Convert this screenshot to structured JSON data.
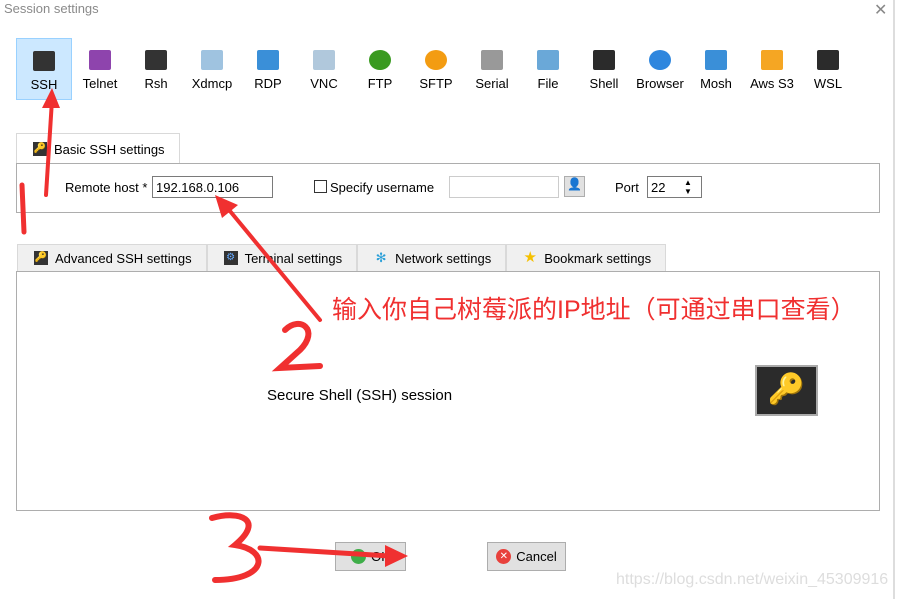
{
  "window": {
    "title": "Session settings",
    "close": "✕"
  },
  "session_types": [
    {
      "label": "SSH",
      "color": "#333333",
      "icon": "key-icon",
      "selected": true
    },
    {
      "label": "Telnet",
      "color": "#8e44ad",
      "icon": "telnet-icon"
    },
    {
      "label": "Rsh",
      "color": "#333333",
      "icon": "gears-icon"
    },
    {
      "label": "Xdmcp",
      "color": "#9fc3e0",
      "icon": "x-monitor-icon"
    },
    {
      "label": "RDP",
      "color": "#3a8fd8",
      "icon": "rdp-monitor-icon"
    },
    {
      "label": "VNC",
      "color": "#b0c8dc",
      "icon": "vnc-monitor-icon"
    },
    {
      "label": "FTP",
      "color": "#3a9a20",
      "icon": "globe-icon"
    },
    {
      "label": "SFTP",
      "color": "#f39c12",
      "icon": "globe-icon"
    },
    {
      "label": "Serial",
      "color": "#999999",
      "icon": "plug-icon"
    },
    {
      "label": "File",
      "color": "#6aa8d8",
      "icon": "file-monitor-icon"
    },
    {
      "label": "Shell",
      "color": "#2b2b2b",
      "icon": "terminal-icon"
    },
    {
      "label": "Browser",
      "color": "#2e86de",
      "icon": "globe-icon"
    },
    {
      "label": "Mosh",
      "color": "#3a8fd8",
      "icon": "satellite-icon"
    },
    {
      "label": "Aws S3",
      "color": "#f5a623",
      "icon": "cubes-icon"
    },
    {
      "label": "WSL",
      "color": "#2b2b2b",
      "icon": "windows-icon"
    }
  ],
  "basic": {
    "tab": "Basic SSH settings",
    "remote_host_label": "Remote host *",
    "remote_host": "192.168.0.106",
    "specify_username": "Specify username",
    "username": "",
    "port_label": "Port",
    "port": "22"
  },
  "tabs": [
    "Advanced SSH settings",
    "Terminal settings",
    "Network settings",
    "Bookmark settings"
  ],
  "panel": {
    "description": "Secure Shell (SSH) session"
  },
  "buttons": {
    "ok": "OK",
    "cancel": "Cancel"
  },
  "annotation": {
    "text": "输入你自己树莓派的IP地址（可通过串口查看）",
    "n1": "1",
    "n2": "2",
    "n3": "3",
    "color": "#f03030"
  },
  "watermark": "https://blog.csdn.net/weixin_45309916"
}
